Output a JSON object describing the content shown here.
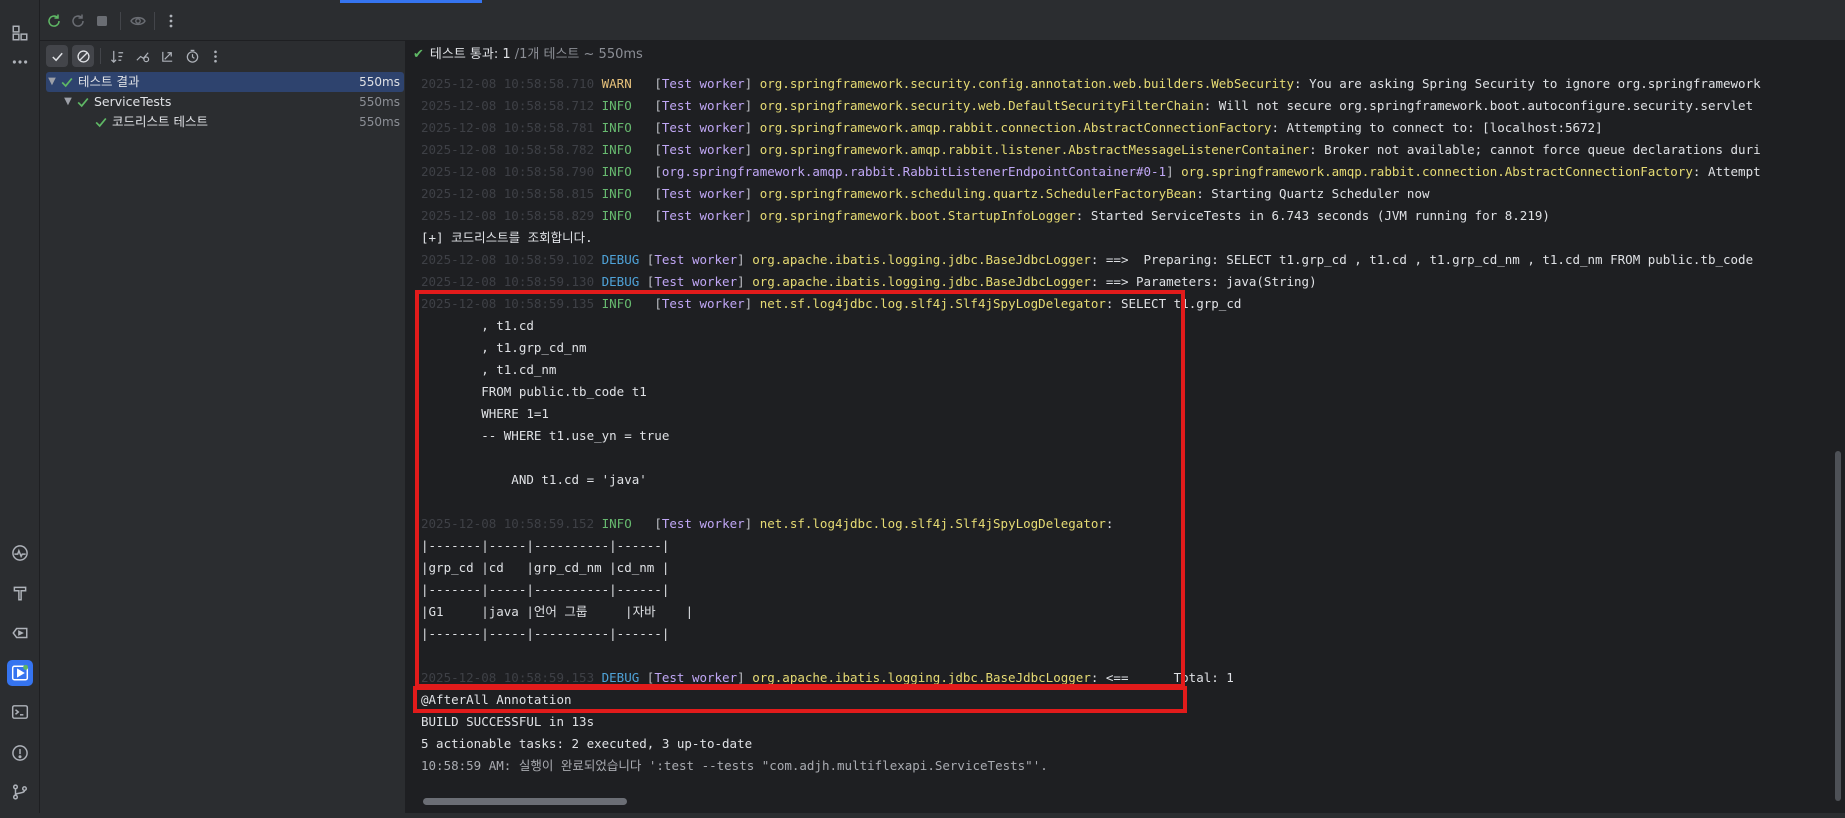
{
  "sidebar": {
    "icons": [
      "structure-icon",
      "more-horizontal-icon",
      "profiler-icon",
      "build-hammer-icon",
      "services-icon",
      "run-icon",
      "terminal-icon",
      "problems-icon",
      "git-branch-icon"
    ]
  },
  "toolbar": {
    "icons": [
      "rerun-icon",
      "rerun-failed-icon",
      "stop-icon",
      "eye-icon",
      "more-vertical-icon"
    ]
  },
  "tree_toolbar": {
    "icons": [
      "show-passed-icon",
      "show-ignored-icon",
      "sort-icon",
      "sort-duration-icon",
      "collapse-icon",
      "history-icon",
      "more-vertical-icon"
    ]
  },
  "tree": {
    "items": [
      {
        "label": "테스트 결과",
        "duration": "550ms",
        "level": 0,
        "selected": true
      },
      {
        "label": "ServiceTests",
        "duration": "550ms",
        "level": 1,
        "selected": false
      },
      {
        "label": "코드리스트 테스트",
        "duration": "550ms",
        "level": 2,
        "selected": false
      }
    ]
  },
  "status": {
    "prefix": "테스트 통과: ",
    "passed": "1",
    "suffix": " /1개 테스트 ~ 550ms"
  },
  "log": {
    "l1": {
      "ts": "2025-12-08 10:58:58.710",
      "level": "WARN ",
      "thread": "Test worker",
      "cls": "org.springframework.security.config.annotation.web.builders.WebSecurity",
      "msg": ": You are asking Spring Security to ignore org.springframework"
    },
    "l2": {
      "ts": "2025-12-08 10:58:58.712",
      "level": "INFO ",
      "thread": "Test worker",
      "cls": "org.springframework.security.web.DefaultSecurityFilterChain",
      "msg": ": Will not secure org.springframework.boot.autoconfigure.security.servlet"
    },
    "l3": {
      "ts": "2025-12-08 10:58:58.781",
      "level": "INFO ",
      "thread": "Test worker",
      "cls": "org.springframework.amqp.rabbit.connection.AbstractConnectionFactory",
      "msg": ": Attempting to connect to: [localhost:5672]"
    },
    "l4": {
      "ts": "2025-12-08 10:58:58.782",
      "level": "INFO ",
      "thread": "Test worker",
      "cls": "org.springframework.amqp.rabbit.listener.AbstractMessageListenerContainer",
      "msg": ": Broker not available; cannot force queue declarations duri"
    },
    "l5": {
      "ts": "2025-12-08 10:58:58.790",
      "level": "INFO ",
      "thread": "org.springframework.amqp.rabbit.RabbitListenerEndpointContainer#0-1",
      "cls": "org.springframework.amqp.rabbit.connection.AbstractConnectionFactory",
      "msg": ": Attempt"
    },
    "l6": {
      "ts": "2025-12-08 10:58:58.815",
      "level": "INFO ",
      "thread": "Test worker",
      "cls": "org.springframework.scheduling.quartz.SchedulerFactoryBean",
      "msg": ": Starting Quartz Scheduler now"
    },
    "l7": {
      "ts": "2025-12-08 10:58:58.829",
      "level": "INFO ",
      "thread": "Test worker",
      "cls": "org.springframework.boot.StartupInfoLogger",
      "msg": ": Started ServiceTests in 6.743 seconds (JVM running for 8.219)"
    },
    "l8": {
      "text": "[+] 코드리스트를 조회합니다."
    },
    "l9": {
      "ts": "2025-12-08 10:58:59.102",
      "level": "DEBUG",
      "thread": "Test worker",
      "cls": "org.apache.ibatis.logging.jdbc.BaseJdbcLogger",
      "msg": ": ==>  Preparing: SELECT t1.grp_cd , t1.cd , t1.grp_cd_nm , t1.cd_nm FROM public.tb_code"
    },
    "l10": {
      "ts": "2025-12-08 10:58:59.130",
      "level": "DEBUG",
      "thread": "Test worker",
      "cls": "org.apache.ibatis.logging.jdbc.BaseJdbcLogger",
      "msg": ": ==> Parameters: java(String)"
    },
    "l11": {
      "ts": "2025-12-08 10:58:59.135",
      "level": "INFO ",
      "thread": "Test worker",
      "cls": "net.sf.log4jdbc.log.slf4j.Slf4jSpyLogDelegator",
      "msg": ": SELECT t1.grp_cd"
    },
    "sql1": "        , t1.cd",
    "sql2": "        , t1.grp_cd_nm",
    "sql3": "        , t1.cd_nm",
    "sql4": "        FROM public.tb_code t1",
    "sql5": "        WHERE 1=1",
    "sql6": "        -- WHERE t1.use_yn = true",
    "sql7": "            AND t1.cd = 'java'",
    "l12": {
      "ts": "2025-12-08 10:58:59.152",
      "level": "INFO ",
      "thread": "Test worker",
      "cls": "net.sf.log4jdbc.log.slf4j.Slf4jSpyLogDelegator",
      "msg": ":"
    },
    "tbl1": "|-------|-----|----------|------|",
    "tbl2": "|grp_cd |cd   |grp_cd_nm |cd_nm |",
    "tbl3": "|-------|-----|----------|------|",
    "tbl4": "|G1     |java |언어 그룹     |자바    |",
    "tbl5": "|-------|-----|----------|------|",
    "l13": {
      "ts": "2025-12-08 10:58:59.153",
      "level": "DEBUG",
      "thread": "Test worker",
      "cls": "org.apache.ibatis.logging.jdbc.BaseJdbcLogger",
      "msg": ": <==      Total: 1"
    },
    "after": "@AfterAll Annotation",
    "build": "BUILD SUCCESSFUL in 13s",
    "tasks": "5 actionable tasks: 2 executed, 3 up-to-date",
    "done": "10:58:59 AM: 실행이 완료되었습니다 ':test --tests \"com.adjh.multiflexapi.ServiceTests\"'."
  },
  "colors": {
    "highlight_box": "#e21b1b",
    "accent": "#3574f0",
    "pass": "#5fb865"
  }
}
